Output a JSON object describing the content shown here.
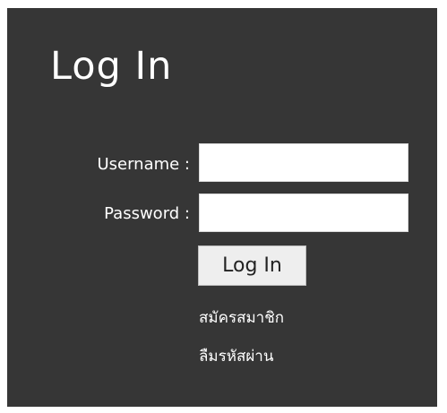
{
  "login": {
    "title": "Log In",
    "username_label": "Username :",
    "username_value": "",
    "password_label": "Password :",
    "password_value": "",
    "submit_label": "Log In",
    "register_link": "สมัครสมาชิก",
    "forgot_password_link": "ลืมรหัสผ่าน"
  },
  "colors": {
    "panel_background": "#363636",
    "page_background": "#ffffff",
    "text": "#ffffff",
    "button_background": "#eeeeee"
  }
}
